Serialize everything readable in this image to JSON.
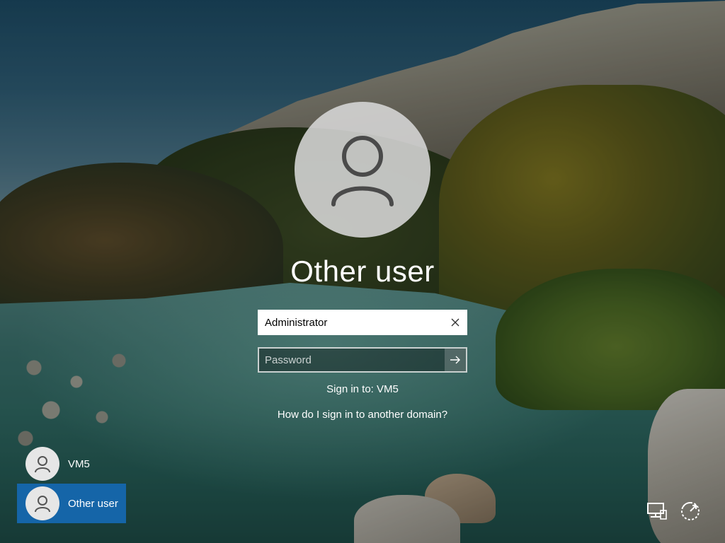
{
  "login": {
    "display_name": "Other user",
    "username_value": "Administrator",
    "password_placeholder": "Password",
    "sign_in_to": "Sign in to: VM5",
    "domain_help_link": "How do I sign in to another domain?"
  },
  "user_list": [
    {
      "label": "VM5",
      "selected": false
    },
    {
      "label": "Other user",
      "selected": true
    }
  ],
  "icons": {
    "clear": "close-icon",
    "submit": "arrow-right-icon",
    "network": "network-icon",
    "ease_of_access": "ease-of-access-icon"
  },
  "colors": {
    "selected_tile": "#1565a8",
    "avatar_bg": "#d7d7d7"
  }
}
